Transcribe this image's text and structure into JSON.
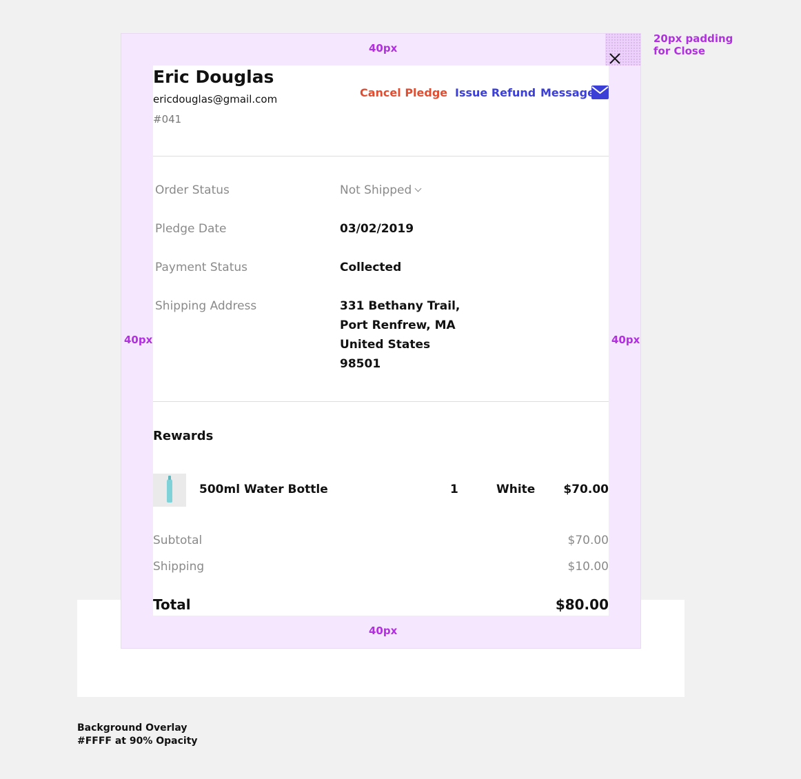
{
  "annotations": {
    "top_padding": "40px",
    "left_padding": "40px",
    "right_padding": "40px",
    "bottom_padding": "40px",
    "close_padding_line1": "20px padding",
    "close_padding_line2": "for Close",
    "overlay_note_line1": "Background Overlay",
    "overlay_note_line2": "#FFFF at 90% Opacity"
  },
  "customer": {
    "name": "Eric Douglas",
    "email": "ericdouglas@gmail.com",
    "order_number": "#041"
  },
  "actions": {
    "cancel_label": "Cancel Pledge",
    "refund_label": "Issue Refund",
    "message_label": "Message"
  },
  "details": {
    "order_status_label": "Order Status",
    "order_status_value": "Not Shipped",
    "pledge_date_label": "Pledge Date",
    "pledge_date_value": "03/02/2019",
    "payment_status_label": "Payment Status",
    "payment_status_value": "Collected",
    "shipping_address_label": "Shipping Address",
    "shipping_address_lines": [
      "331 Bethany Trail,",
      "Port Renfrew, MA",
      "United States",
      "98501"
    ]
  },
  "rewards": {
    "title": "Rewards",
    "items": [
      {
        "name": "500ml Water Bottle",
        "quantity": "1",
        "color": "White",
        "price": "$70.00"
      }
    ]
  },
  "summary": {
    "subtotal_label": "Subtotal",
    "subtotal_value": "$70.00",
    "shipping_label": "Shipping",
    "shipping_value": "$10.00",
    "total_label": "Total",
    "total_value": "$80.00"
  },
  "icons": {
    "close": "close-icon",
    "message": "mail-icon",
    "status_dropdown": "chevron-down-icon"
  },
  "colors": {
    "cancel": "#e04e32",
    "refund": "#3b3fd6",
    "message": "#3b3fd6",
    "annotation": "#b030e0",
    "padding_area": "#f5e7fd"
  }
}
